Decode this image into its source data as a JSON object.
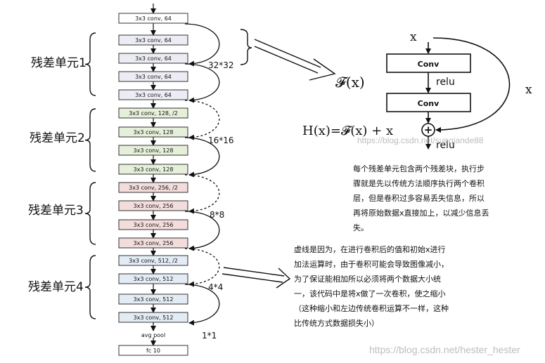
{
  "colors": {
    "gray_fill": "#ececf4",
    "green_fill": "#e6efd9",
    "pink_fill": "#f2dcdc",
    "blue_fill": "#e3ebf4",
    "white_fill": "#ffffff",
    "stroke": "#111111"
  },
  "network": {
    "layers": [
      {
        "label": "3x3 conv, 64",
        "fill": "#ffffff"
      },
      {
        "label": "3x3 conv, 64",
        "fill": "#ececf4"
      },
      {
        "label": "3x3 conv, 64",
        "fill": "#ececf4"
      },
      {
        "label": "3x3 conv, 64",
        "fill": "#ececf4"
      },
      {
        "label": "3x3 conv, 64",
        "fill": "#ececf4"
      },
      {
        "label": "3x3 conv, 128, /2",
        "fill": "#e6efd9"
      },
      {
        "label": "3x3 conv, 128",
        "fill": "#e6efd9"
      },
      {
        "label": "3x3 conv, 128",
        "fill": "#e6efd9"
      },
      {
        "label": "3x3 conv, 128",
        "fill": "#e6efd9"
      },
      {
        "label": "3x3 conv, 256, /2",
        "fill": "#f2dcdc"
      },
      {
        "label": "3x3 conv, 256",
        "fill": "#f2dcdc"
      },
      {
        "label": "3x3 conv, 256",
        "fill": "#f2dcdc"
      },
      {
        "label": "3x3 conv, 256",
        "fill": "#f2dcdc"
      },
      {
        "label": "3x3 conv, 512, /2",
        "fill": "#e3ebf4"
      },
      {
        "label": "3x3 conv, 512",
        "fill": "#e3ebf4"
      },
      {
        "label": "3x3 conv, 512",
        "fill": "#e3ebf4"
      },
      {
        "label": "3x3 conv, 512",
        "fill": "#e3ebf4"
      },
      {
        "label": "avg pool",
        "fill": "none"
      },
      {
        "label": "fc 10",
        "fill": "#ffffff"
      }
    ],
    "units": [
      {
        "label": "残差单元1",
        "size_label": "32*32"
      },
      {
        "label": "残差单元2",
        "size_label": "16*16"
      },
      {
        "label": "残差单元3",
        "size_label": "8*8"
      },
      {
        "label": "残差单元4",
        "size_label": "4*4"
      }
    ],
    "final_size_label": "1*1"
  },
  "block": {
    "input_label": "x",
    "conv_label": "Conv",
    "relu_label": "relu",
    "skip_label": "x",
    "plus_symbol": "+",
    "out_relu_label": "relu",
    "fx_label": "𝓕(x)",
    "equation": "H(x)=𝓕(x) + x"
  },
  "notes": {
    "note1": "每个残差单元包含两个残差块，执行步骤就是先以传统方法顺序执行两个卷积层，但是卷积过多容易丢失信息，所以再将原始数据x直接加上，以减少信息丢失。",
    "note2": "虚线是因为，在进行卷积后的值和初始x进行加法运算时，由于卷积可能会导致图像减小，为了保证能相加所以必须将两个数据大小统一，该代码中是将x做了一次卷积，使之缩小（这种缩小和左边传统卷积运算不一样，这种比传统方式数据损失小）"
  },
  "watermarks": {
    "mid": "https://blog.csdn.net/sunqiande88",
    "bottom": "https://blog.csdn.net/hester_hester"
  }
}
